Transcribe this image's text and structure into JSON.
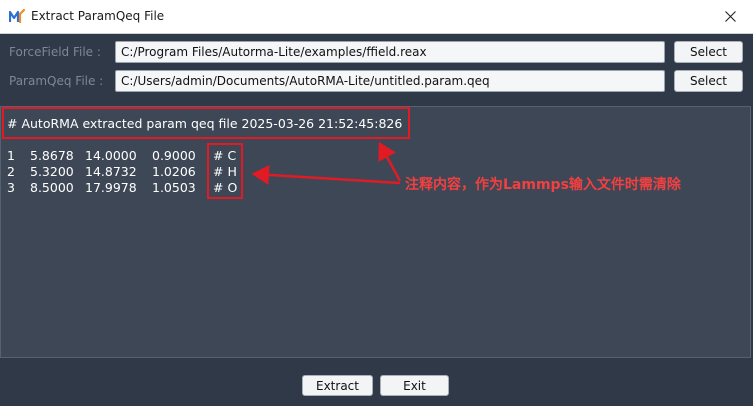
{
  "window": {
    "title": "Extract ParamQeq File"
  },
  "forcefield": {
    "label": "ForceField File :",
    "value": "C:/Program Files/Autorma-Lite/examples/ffield.reax",
    "button": "Select"
  },
  "paramqeq": {
    "label": "ParamQeq  File  :",
    "value": "C:/Users/admin/Documents/AutoRMA-Lite/untitled.param.qeq",
    "button": "Select"
  },
  "output": {
    "header": "# AutoRMA extracted param qeq file 2025-03-26 21:52:45:826",
    "rows": [
      {
        "idx": "1",
        "v1": "5.8678",
        "v2": "14.0000",
        "v3": "0.9000",
        "comment": "# C"
      },
      {
        "idx": "2",
        "v1": "5.3200",
        "v2": "14.8732",
        "v3": "1.0206",
        "comment": "# H"
      },
      {
        "idx": "3",
        "v1": "8.5000",
        "v2": "17.9978",
        "v3": "1.0503",
        "comment": "# O"
      }
    ]
  },
  "annotation": {
    "text": "注释内容，作为Lammps输入文件时需清除"
  },
  "buttons": {
    "extract": "Extract",
    "exit": "Exit"
  },
  "colors": {
    "background": "#2f3948",
    "output_bg": "#3e4756",
    "annotation": "#e01b24"
  },
  "icons": {
    "app": "app-logo-icon",
    "close": "close-icon"
  }
}
